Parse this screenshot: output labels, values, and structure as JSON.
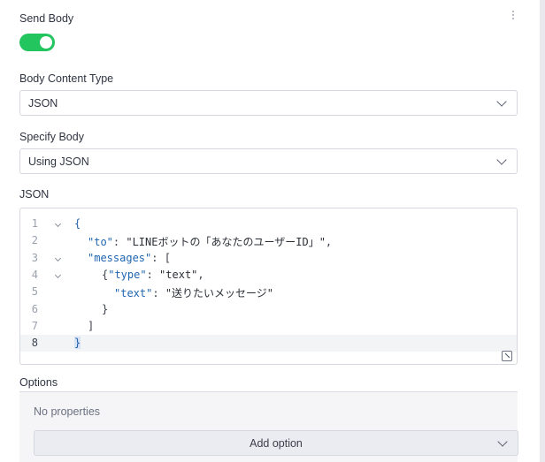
{
  "send_body": {
    "label": "Send Body",
    "enabled": true
  },
  "body_content_type": {
    "label": "Body Content Type",
    "value": "JSON"
  },
  "specify_body": {
    "label": "Specify Body",
    "value": "Using JSON"
  },
  "json_editor": {
    "label": "JSON",
    "active_line": 8,
    "lines": [
      {
        "n": "1",
        "fold": true,
        "tokens": [
          {
            "t": "{",
            "c": "brace"
          }
        ]
      },
      {
        "n": "2",
        "fold": false,
        "tokens": [
          {
            "t": "\"to\"",
            "c": "key"
          },
          {
            "t": ": ",
            "c": "punct"
          },
          {
            "t": "\"LINEボットの「あなたのユーザーID」\"",
            "c": "str"
          },
          {
            "t": ",",
            "c": "punct"
          }
        ]
      },
      {
        "n": "3",
        "fold": true,
        "tokens": [
          {
            "t": "\"messages\"",
            "c": "key"
          },
          {
            "t": ": [",
            "c": "punct"
          }
        ]
      },
      {
        "n": "4",
        "fold": true,
        "tokens": [
          {
            "t": "{",
            "c": "punct"
          },
          {
            "t": "\"type\"",
            "c": "key"
          },
          {
            "t": ": ",
            "c": "punct"
          },
          {
            "t": "\"text\"",
            "c": "str"
          },
          {
            "t": ",",
            "c": "punct"
          }
        ]
      },
      {
        "n": "5",
        "fold": false,
        "tokens": [
          {
            "t": "\"text\"",
            "c": "key"
          },
          {
            "t": ": ",
            "c": "punct"
          },
          {
            "t": "\"送りたいメッセージ\"",
            "c": "str"
          }
        ]
      },
      {
        "n": "6",
        "fold": false,
        "tokens": [
          {
            "t": "}",
            "c": "punct"
          }
        ]
      },
      {
        "n": "7",
        "fold": false,
        "tokens": [
          {
            "t": "]",
            "c": "punct"
          }
        ]
      },
      {
        "n": "8",
        "fold": false,
        "tokens": [
          {
            "t": "}",
            "c": "brace-hl"
          }
        ]
      }
    ]
  },
  "options": {
    "label": "Options",
    "empty_text": "No properties",
    "add_label": "Add option"
  },
  "colors": {
    "toggle_on": "#22c55e",
    "json_key": "#2066b0",
    "brace": "#1f5fa8"
  },
  "icons": {
    "menu": "kebab-vertical-icon",
    "dropdown": "chevron-down-icon",
    "resize": "resize-corner-icon"
  }
}
